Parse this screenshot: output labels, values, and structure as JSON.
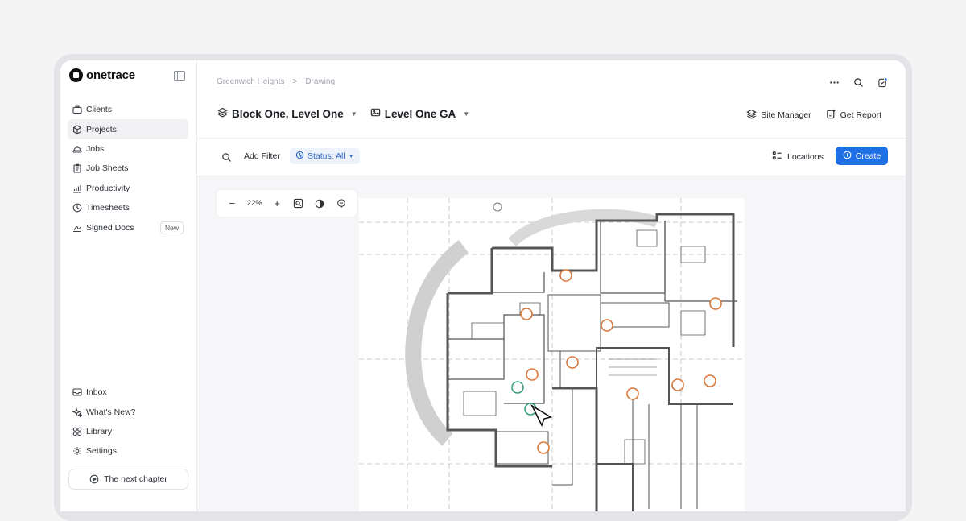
{
  "brand": {
    "name": "onetrace"
  },
  "sidebar": {
    "items": [
      {
        "label": "Clients",
        "icon": "briefcase-icon"
      },
      {
        "label": "Projects",
        "icon": "cube-icon",
        "active": true
      },
      {
        "label": "Jobs",
        "icon": "hardhat-icon"
      },
      {
        "label": "Job Sheets",
        "icon": "clipboard-icon"
      },
      {
        "label": "Productivity",
        "icon": "chart-icon"
      },
      {
        "label": "Timesheets",
        "icon": "clock-icon"
      },
      {
        "label": "Signed Docs",
        "icon": "signature-icon",
        "badge": "New"
      }
    ],
    "bottom_items": [
      {
        "label": "Inbox",
        "icon": "inbox-icon"
      },
      {
        "label": "What's New?",
        "icon": "sparkle-icon"
      },
      {
        "label": "Library",
        "icon": "grid-icon"
      },
      {
        "label": "Settings",
        "icon": "gear-icon"
      }
    ],
    "chapter_button": "The next chapter"
  },
  "breadcrumb": {
    "project": "Greenwich Heights",
    "page": "Drawing",
    "separator": ">"
  },
  "header": {
    "location_selector": "Block One, Level One",
    "drawing_selector": "Level One GA",
    "site_manager": "Site Manager",
    "get_report": "Get Report"
  },
  "toolbar": {
    "add_filter": "Add Filter",
    "status_filter": "Status: All",
    "locations": "Locations",
    "create": "Create"
  },
  "viewer": {
    "zoom": "22%"
  },
  "colors": {
    "accent": "#1f6fe5",
    "pin_orange": "#d9783a",
    "pin_green": "#3aa07a"
  }
}
